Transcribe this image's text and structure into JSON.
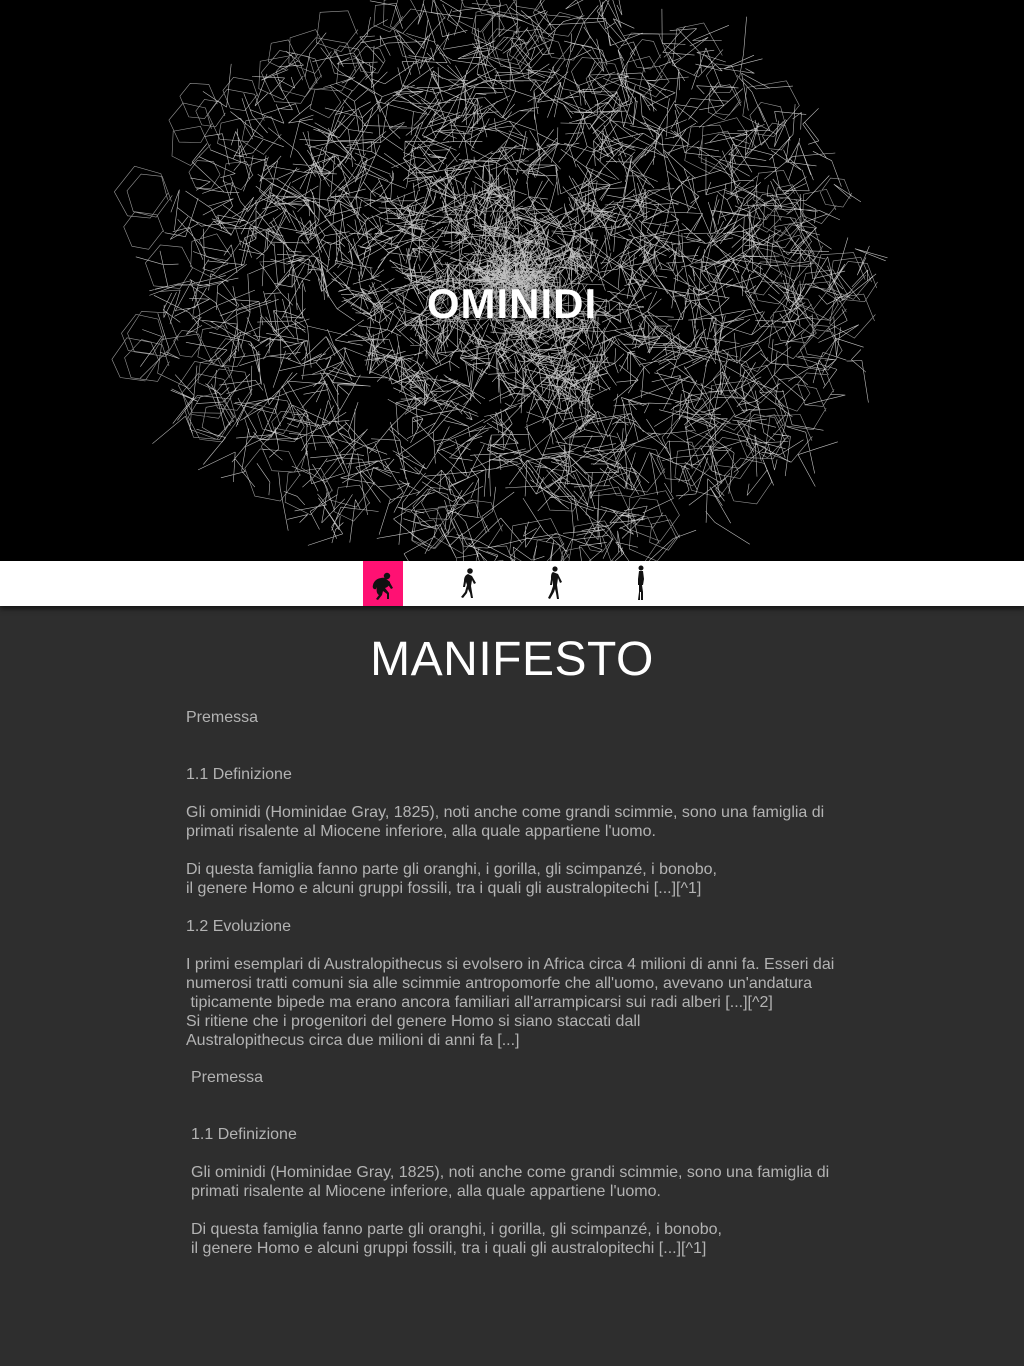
{
  "hero": {
    "title": "OMINIDI"
  },
  "nav": {
    "items": [
      {
        "name": "evolution-stage-1",
        "icon": "crouching-hominid-icon",
        "active": true
      },
      {
        "name": "evolution-stage-2",
        "icon": "stooped-hominid-icon",
        "active": false
      },
      {
        "name": "evolution-stage-3",
        "icon": "walking-hominid-icon",
        "active": false
      },
      {
        "name": "evolution-stage-4",
        "icon": "upright-human-icon",
        "active": false
      }
    ],
    "accent_color": "#ff1173"
  },
  "manifesto": {
    "title": "MANIFESTO",
    "block1": {
      "premessa": "Premessa",
      "h_definizione": "1.1 Definizione",
      "p_definizione_1": "Gli ominidi (Hominidae Gray, 1825), noti anche come grandi scimmie, sono una famiglia di",
      "p_definizione_2": "primati risalente al Miocene inferiore, alla quale appartiene l'uomo.",
      "p_famiglia_1": "Di questa famiglia fanno parte gli oranghi, i gorilla, gli scimpanzé, i bonobo,",
      "p_famiglia_2": "il genere Homo e alcuni gruppi fossili, tra i quali gli australopitechi [...][^1]",
      "h_evoluzione": "1.2 Evoluzione",
      "p_evoluzione_1": "I primi esemplari di Australopithecus si evolsero in Africa circa 4 milioni di anni fa. Esseri dai",
      "p_evoluzione_2": "numerosi tratti comuni sia alle scimmie antropomorfe che all'uomo, avevano un'andatura",
      "p_evoluzione_3": " tipicamente bipede ma erano ancora familiari all'arrampicarsi sui radi alberi [...][^2]",
      "p_evoluzione_4": "Si ritiene che i progenitori del genere Homo si siano staccati dall",
      "p_evoluzione_5": "Australopithecus circa due milioni di anni fa [...]"
    },
    "block2": {
      "premessa": "Premessa",
      "h_definizione": "1.1 Definizione",
      "p_definizione_1": "Gli ominidi (Hominidae Gray, 1825), noti anche come grandi scimmie, sono una famiglia di",
      "p_definizione_2": "primati risalente al Miocene inferiore, alla quale appartiene l'uomo.",
      "p_famiglia_1": "Di questa famiglia fanno parte gli oranghi, i gorilla, gli scimpanzé, i bonobo,",
      "p_famiglia_2": "il genere Homo e alcuni gruppi fossili, tra i quali gli australopitechi [...][^1]"
    }
  }
}
